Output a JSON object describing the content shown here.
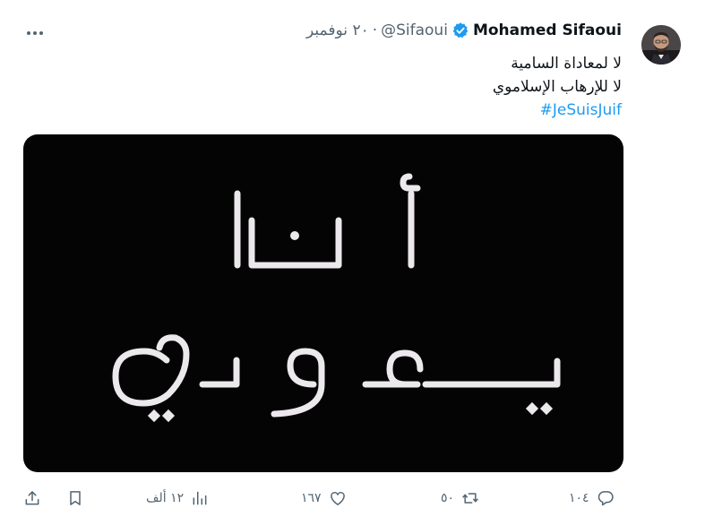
{
  "tweet": {
    "author_name": "Mohamed Sifaoui",
    "handle": "@Sifaoui",
    "separator": "·",
    "date": "٢٠ نوفمبر",
    "lines": [
      "لا لمعاداة السامية",
      "لا للإرهاب الإسلاموي"
    ],
    "hashtag": "#JeSuisJuif",
    "media_text": [
      "أنا",
      "يهودي"
    ]
  },
  "actions": {
    "replies": "١٠٤",
    "retweets": "٥٠",
    "likes": "١٦٧",
    "views": "١٢ ألف"
  },
  "colors": {
    "text": "#0f1419",
    "muted": "#536471",
    "link": "#1d9bf0",
    "verified": "#1d9bf0",
    "media_bg": "#050405"
  },
  "icons": [
    "more-icon",
    "verified-icon",
    "avatar",
    "reply-icon",
    "retweet-icon",
    "like-icon",
    "views-icon",
    "bookmark-icon",
    "share-icon"
  ]
}
